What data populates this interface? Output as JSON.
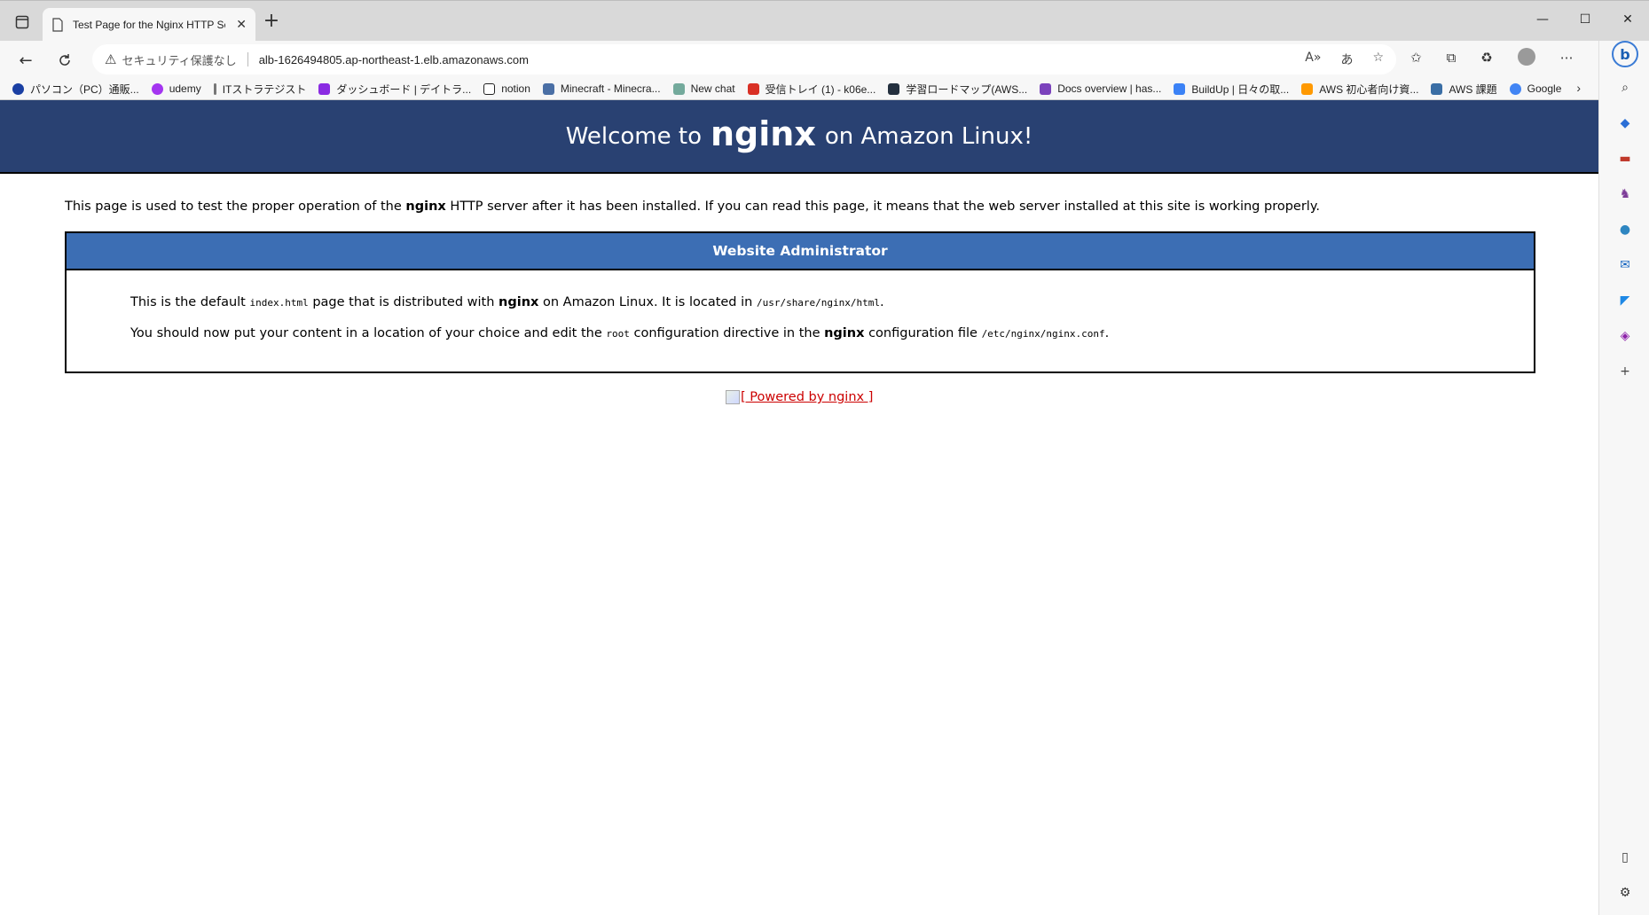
{
  "browser": {
    "tab_title": "Test Page for the Nginx HTTP Ser",
    "security_label": "セキュリティ保護なし",
    "url": "alb-1626494805.ap-northeast-1.elb.amazonaws.com"
  },
  "favorites": [
    {
      "label": "パソコン（PC）通販...",
      "color": "#1a3fa3"
    },
    {
      "label": "udemy",
      "color": "#a435f0"
    },
    {
      "label": "ITストラテジスト",
      "color": "#777777"
    },
    {
      "label": "ダッシュボード | デイトラ...",
      "color": "#8a2be2"
    },
    {
      "label": "notion",
      "color": "#222222"
    },
    {
      "label": "Minecraft - Minecra...",
      "color": "#4a6fa5"
    },
    {
      "label": "New chat",
      "color": "#74aa9c"
    },
    {
      "label": "受信トレイ (1) - k06e...",
      "color": "#d93025"
    },
    {
      "label": "学習ロードマップ(AWS...",
      "color": "#232f3e"
    },
    {
      "label": "Docs overview | has...",
      "color": "#7b42bc"
    },
    {
      "label": "BuildUp | 日々の取...",
      "color": "#3b82f6"
    },
    {
      "label": "AWS 初心者向け資...",
      "color": "#ff9900"
    },
    {
      "label": "AWS 課題",
      "color": "#3a6ea5"
    },
    {
      "label": "Google",
      "color": "#4285f4"
    }
  ],
  "page": {
    "banner_prefix": "Welcome to",
    "banner_brand": "nginx",
    "banner_suffix": "on Amazon Linux!",
    "intro_a": "This page is used to test the proper operation of the",
    "intro_brand": "nginx",
    "intro_b": "HTTP server after it has been installed. If you can read this page, it means that the web server installed at this site is working properly.",
    "box_header": "Website Administrator",
    "p1_a": "This is the default",
    "p1_code1": "index.html",
    "p1_b": "page that is distributed with",
    "p1_brand": "nginx",
    "p1_c": "on Amazon Linux. It is located in",
    "p1_code2": "/usr/share/nginx/html",
    "p1_d": ".",
    "p2_a": "You should now put your content in a location of your choice and edit the",
    "p2_code1": "root",
    "p2_b": "configuration directive in the",
    "p2_brand": "nginx",
    "p2_c": "configuration file",
    "p2_code2": "/etc/nginx/nginx.conf",
    "p2_d": ".",
    "powered_alt": "[ Powered by nginx ]"
  },
  "colors": {
    "banner_bg": "#294172",
    "box_header_bg": "#3c6eb4",
    "link": "#cc0000"
  }
}
